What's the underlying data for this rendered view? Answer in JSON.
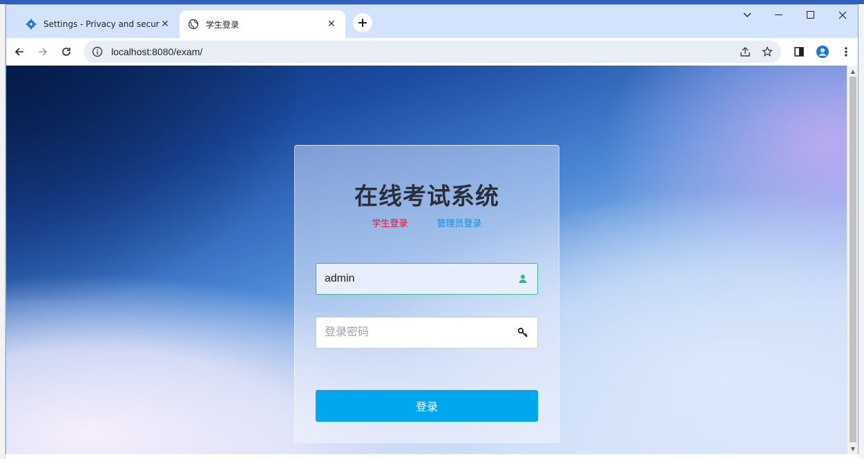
{
  "browser": {
    "tabs": [
      {
        "title": "Settings - Privacy and security",
        "icon": "gear-icon",
        "active": false
      },
      {
        "title": "学生登录",
        "icon": "globe-icon",
        "active": true
      }
    ],
    "address_bar": {
      "url": "localhost:8080/exam/"
    }
  },
  "page": {
    "title": "在线考试系统",
    "role_tabs": {
      "student": "学生登录",
      "admin": "管理员登录"
    },
    "username": {
      "value": "admin",
      "placeholder": ""
    },
    "password": {
      "value": "",
      "placeholder": "登录密码"
    },
    "login_button": "登录"
  },
  "colors": {
    "student_tab": "#e8112d",
    "admin_tab": "#1a8fd4",
    "login_button": "#00a7ef",
    "focus_border": "#2dbb82",
    "user_icon": "#2dbb82"
  }
}
